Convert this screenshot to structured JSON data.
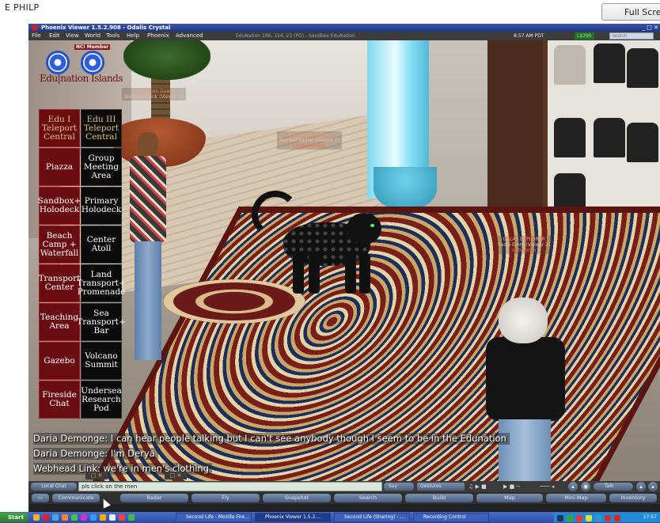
{
  "presenter": {
    "name": "E PHILP",
    "fullscreen_label": "Full Scre"
  },
  "window": {
    "title": "Phoenix Viewer 1.5.2.908 - Odalis Crystal"
  },
  "menubar": {
    "items": [
      "File",
      "Edit",
      "View",
      "World",
      "Tools",
      "Help",
      "Phoenix",
      "Advanced"
    ],
    "region": "EduNation 106, 154, 23 (PG) - Sandbox EduNation",
    "time": "8:57 AM PDT",
    "balance": "L$390",
    "search_placeholder": "Search"
  },
  "hud": {
    "badge": "NCI Member",
    "brand": "Edu|nation Islands",
    "buttons": [
      {
        "label": "Edu I Teleport Central",
        "style": "red gold"
      },
      {
        "label": "Edu III Teleport Central",
        "style": "black gold"
      },
      {
        "label": "Piazza",
        "style": "red"
      },
      {
        "label": "Group Meeting Area",
        "style": "black"
      },
      {
        "label": "Sandbox+ Holodeck",
        "style": "red"
      },
      {
        "label": "Primary Holodeck",
        "style": "black"
      },
      {
        "label": "Beach Camp + Waterfall",
        "style": "red"
      },
      {
        "label": "Center Atoll",
        "style": "black"
      },
      {
        "label": "Transport Center",
        "style": "red"
      },
      {
        "label": "Land Transport+ Promenade",
        "style": "black"
      },
      {
        "label": "Teaching Area",
        "style": "red"
      },
      {
        "label": "Sea Transport+ Bar",
        "style": "black"
      },
      {
        "label": "Gazebo",
        "style": "red"
      },
      {
        "label": "Volcano Summit",
        "style": "black"
      },
      {
        "label": "Fireside Chat",
        "style": "red"
      },
      {
        "label": "Undersea Research Pod",
        "style": "black"
      }
    ]
  },
  "name_tags": {
    "guest": {
      "line1": "EduNation Guest",
      "line2": "Webhead Link (Viewer 2)"
    },
    "owner": {
      "line1": "EduNation Owner",
      "line2": "Randall Sadler (Viewer 2)",
      "line3": "randall.sadler"
    },
    "explorer": {
      "line1": "CALAS EXPLORER",
      "line2": "Suzie Emm (Viewer 2)",
      "line3": "suzieemm"
    }
  },
  "chat": {
    "lines": [
      "Daria Demonge: I can hear people talking but I can't see anybody though I seem to be in the Edunation",
      "Daria Demonge: I'm Derya",
      "Webhead Link: we're in men's clothing"
    ],
    "input_value": "pls click on the men",
    "local_chat_label": "Local Chat",
    "say_label": "Say",
    "gestures_label": "Gestures",
    "talk_label": "Talk"
  },
  "toolbar": {
    "buttons": [
      "Communicate",
      "Radar",
      "Fly",
      "Snapshot",
      "Search",
      "Build",
      "Map",
      "Mini-Map",
      "Inventory"
    ]
  },
  "taskbar": {
    "start": "Start",
    "items": [
      "Second Life - Mozilla Fire...",
      "Phoenix Viewer 1.5.2....",
      "Second Life (Sharing) - ...",
      "Recording Control"
    ],
    "clock": "17:57"
  }
}
